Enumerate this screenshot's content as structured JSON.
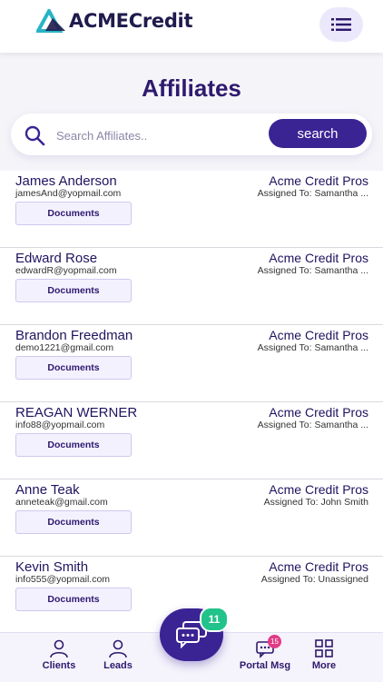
{
  "header": {
    "logo_text": "ACMECredit"
  },
  "page": {
    "title": "Affiliates"
  },
  "search": {
    "placeholder": "Search Affiliates..",
    "button_label": "search"
  },
  "affiliates": [
    {
      "name": "James Anderson",
      "email": "jamesAnd@yopmail.com",
      "company": "Acme Credit Pros",
      "assigned": "Assigned To: Samantha ...",
      "docs_label": "Documents"
    },
    {
      "name": "Edward Rose",
      "email": "edwardR@yopmail.com",
      "company": "Acme Credit Pros",
      "assigned": "Assigned To: Samantha ...",
      "docs_label": "Documents"
    },
    {
      "name": "Brandon Freedman",
      "email": "demo1221@gmail.com",
      "company": "Acme Credit Pros",
      "assigned": "Assigned To: Samantha ...",
      "docs_label": "Documents"
    },
    {
      "name": "REAGAN WERNER",
      "email": "info88@yopmail.com",
      "company": "Acme Credit Pros",
      "assigned": "Assigned To: Samantha ...",
      "docs_label": "Documents"
    },
    {
      "name": "Anne Teak",
      "email": "anneteak@gmail.com",
      "company": "Acme Credit Pros",
      "assigned": "Assigned To: John Smith",
      "docs_label": "Documents"
    },
    {
      "name": "Kevin Smith",
      "email": "info555@yopmail.com",
      "company": "Acme Credit Pros",
      "assigned": "Assigned To: Unassigned",
      "docs_label": "Documents"
    }
  ],
  "chat": {
    "badge": "11",
    "icon": "chat-bubbles-icon"
  },
  "bottom_nav": {
    "clients": "Clients",
    "leads": "Leads",
    "portal_msg": "Portal Msg",
    "portal_badge": "15",
    "more": "More"
  },
  "colors": {
    "primary": "#3a2494",
    "title": "#2e1a6e",
    "chat_badge": "#21c38a",
    "portal_badge": "#e23a86",
    "logo_teal": "#2ab3c6"
  }
}
